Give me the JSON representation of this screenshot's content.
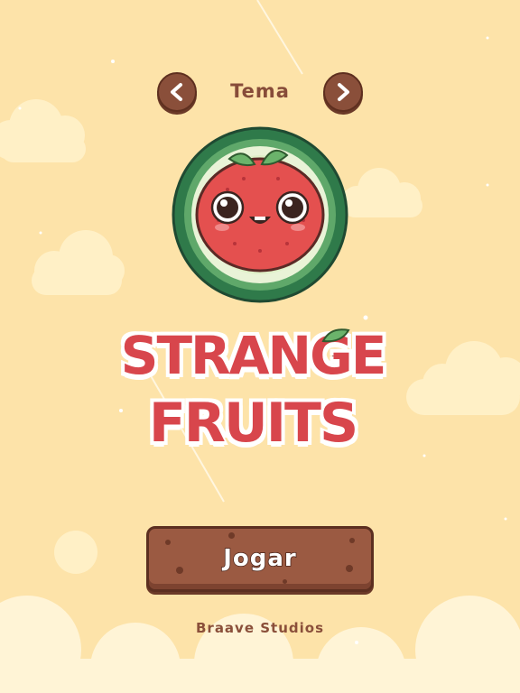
{
  "theme": {
    "label": "Tema",
    "prev_icon": "chevron-left-icon",
    "next_icon": "chevron-right-icon"
  },
  "mascot": "watermelon-face",
  "logo": {
    "line1": "STRANGE",
    "line2": "FRUITS"
  },
  "play_button": {
    "label": "Jogar"
  },
  "footer": {
    "studio": "Braave Studios"
  },
  "colors": {
    "background": "#fde3a9",
    "cloud": "#fff0c6",
    "brown": "#8a4f3a",
    "logo_red": "#d8464c",
    "watermelon_green": "#2f7a4a"
  }
}
